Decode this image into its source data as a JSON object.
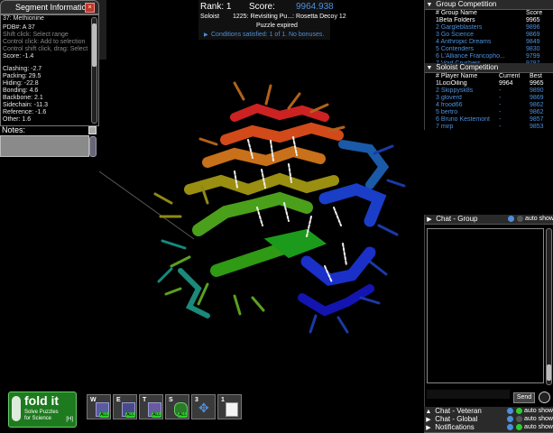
{
  "segment_panel": {
    "title": "Segment Information",
    "residue": "37: Methionine",
    "pdb": "PDB#: A 37",
    "hint1": "Shift click: Select range",
    "hint2": "Control click: Add to selection",
    "hint3": "Control shift click, drag: Select",
    "score": "Score: -1.4",
    "clashing": "Clashing: -2.7",
    "packing": "Packing: 29.5",
    "hiding": "Hiding: -22.8",
    "bonding": "Bonding: 4.6",
    "backbone": "Backbone: 2.1",
    "sidechain": "Sidechain: -11.3",
    "reference": "Reference: -1.6",
    "other": "Other: 1.6",
    "notes_label": "Notes:",
    "notes_value": ""
  },
  "score_header": {
    "rank": "Rank: 1",
    "score_label": "Score:",
    "score_value": "9964.938",
    "mode": "Soloist",
    "puzzle": "1225: Revisiting Pu...: Rosetta Decoy 12",
    "status": "Puzzle expired",
    "conditions": "Conditions satisfied: 1 of 1. No bonuses."
  },
  "group_competition": {
    "title": "Group Competition",
    "col_name": "# Group Name",
    "col_score": "Score",
    "rows": [
      {
        "name": "1Beta Folders",
        "score": "9965"
      },
      {
        "name": "2 Gargleblasters",
        "score": "9896"
      },
      {
        "name": "3 Go Science",
        "score": "9869"
      },
      {
        "name": "4 Anthropic Dreams",
        "score": "9849"
      },
      {
        "name": "5 Contenders",
        "score": "9830"
      },
      {
        "name": "6 L'Alliance Francopho...",
        "score": "9799"
      },
      {
        "name": "7 Void Crushers",
        "score": "9787"
      }
    ]
  },
  "soloist_competition": {
    "title": "Soloist Competition",
    "col_name": "# Player Name",
    "col_current": "Current",
    "col_best": "Best",
    "rows": [
      {
        "name": "1LociOiling",
        "current": "9964",
        "best": "9965"
      },
      {
        "name": "2 Skippysk8s",
        "current": "-",
        "best": "9890"
      },
      {
        "name": "3 gloverd",
        "current": "-",
        "best": "9869"
      },
      {
        "name": "4 frood66",
        "current": "-",
        "best": "9862"
      },
      {
        "name": "5 bertro",
        "current": "-",
        "best": "9862"
      },
      {
        "name": "6 Bruno Kestemont",
        "current": "-",
        "best": "9857"
      },
      {
        "name": "7 mirp",
        "current": "-",
        "best": "9853"
      }
    ]
  },
  "chat": {
    "group_title": "Chat - Group",
    "auto_show": "auto show",
    "send": "Send",
    "veteran_title": "Chat - Veteran",
    "global_title": "Chat - Global",
    "notifications_title": "Notifications"
  },
  "toolbar": {
    "logo_main": "fold it",
    "logo_sub1": "Solve Puzzles",
    "logo_sub2": "for Science",
    "logo_key": "[H]",
    "tools": [
      {
        "key": "W",
        "badge": "ALL"
      },
      {
        "key": "E",
        "badge": "ALL"
      },
      {
        "key": "T",
        "badge": "ALL"
      },
      {
        "key": "S",
        "badge": "ALL"
      },
      {
        "key": "3",
        "badge": ""
      },
      {
        "key": "1",
        "badge": ""
      }
    ]
  },
  "colors": {
    "accent_blue": "#4d8fdb",
    "send_green": "#2ecc2e",
    "panel_bg": "#1a1a1a"
  }
}
